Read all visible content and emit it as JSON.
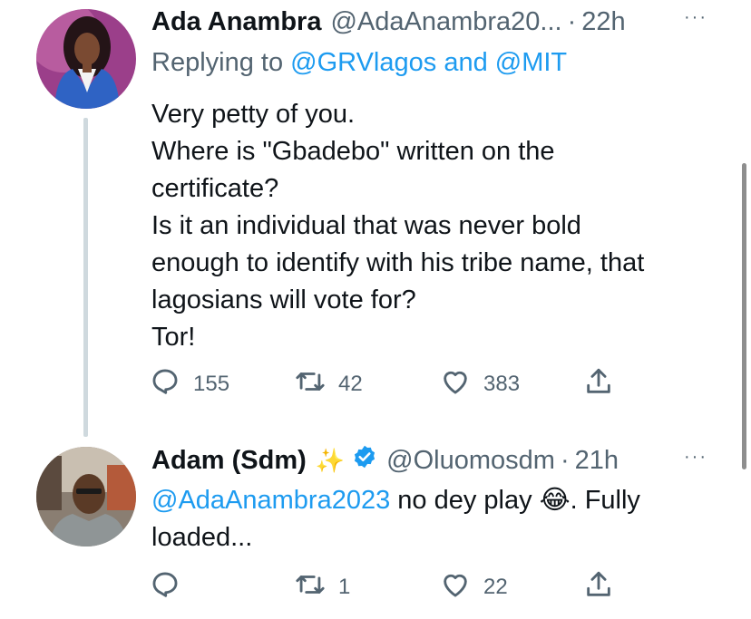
{
  "tweet1": {
    "name": "Ada Anambra",
    "handle": "@AdaAnambra20...",
    "time": "22h",
    "replying_prefix": "Replying to",
    "mention_1": "@GRVlagos",
    "and": "and",
    "mention_2": "@MIT",
    "lines": [
      "Very petty of you.",
      "Where is \"Gbadebo\" written on the",
      "certificate?",
      "Is it an individual that was never bold",
      "enough to identify with his tribe name, that",
      "lagosians will vote for?",
      "Tor!"
    ],
    "replies": "155",
    "retweets": "42",
    "likes": "383"
  },
  "tweet2": {
    "name": "Adam (Sdm)",
    "sparkle": "✨",
    "handle": "@Oluomosdm",
    "time": "21h",
    "mention": "@AdaAnambra2023",
    "text_a": " no dey play ",
    "emoji": "😂",
    "text_b": ". Fully",
    "line2": "loaded...",
    "retweets": "1",
    "likes": "22"
  },
  "icons": {
    "more": "more-horizontal-icon",
    "reply": "reply-icon",
    "retweet": "retweet-icon",
    "like": "heart-icon",
    "share": "share-icon",
    "verified": "verified-badge-icon"
  },
  "colors": {
    "link": "#1d9bf0",
    "secondary": "#536471",
    "text": "#0f1419",
    "thread_line": "#cfd9de"
  },
  "separators": {
    "dot": "·",
    "more": "···"
  }
}
